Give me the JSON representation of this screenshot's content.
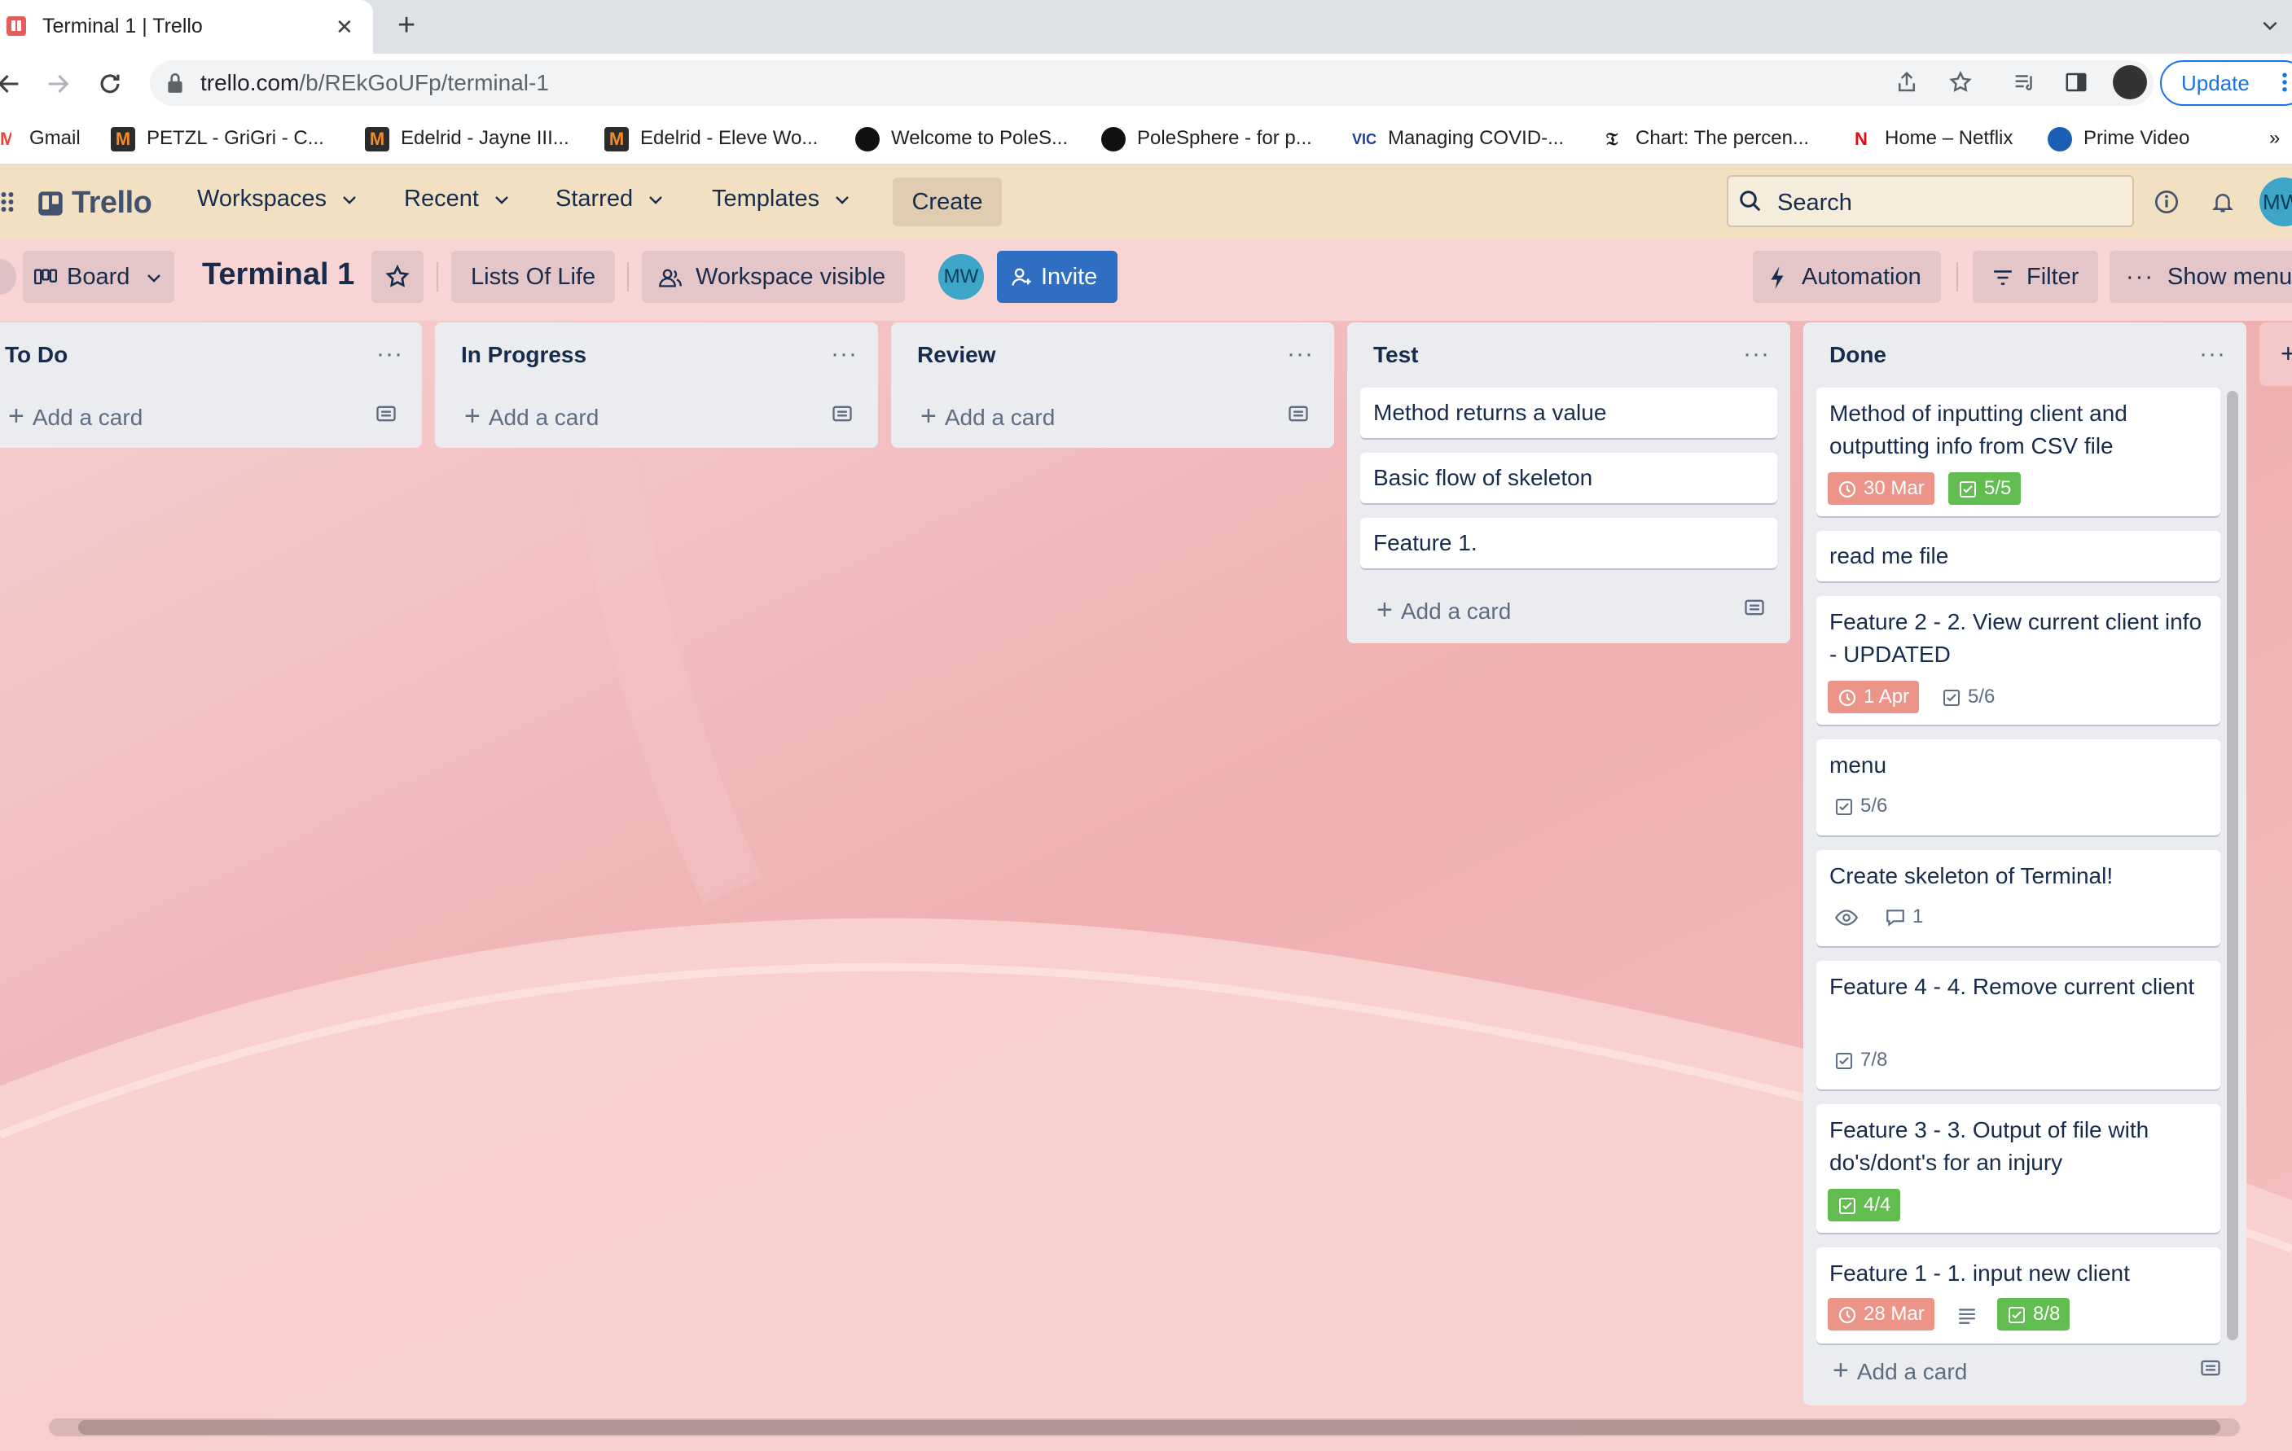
{
  "browser": {
    "tab_title": "Terminal 1 | Trello",
    "url_host": "trello.com",
    "url_path": "/b/REkGoUFp/terminal-1",
    "update_label": "Update",
    "bookmarks": [
      {
        "label": "Gmail",
        "icon": "gmail-icon"
      },
      {
        "label": "PETZL - GriGri - C...",
        "icon": "m-icon"
      },
      {
        "label": "Edelrid - Jayne III...",
        "icon": "m-icon"
      },
      {
        "label": "Edelrid - Eleve Wo...",
        "icon": "m-icon"
      },
      {
        "label": "Welcome to PoleS...",
        "icon": "polesphere-icon"
      },
      {
        "label": "PoleSphere - for p...",
        "icon": "polesphere-icon"
      },
      {
        "label": "Managing COVID-...",
        "icon": "vic-icon"
      },
      {
        "label": "Chart: The percen...",
        "icon": "nyt-icon"
      },
      {
        "label": "Home – Netflix",
        "icon": "netflix-icon"
      },
      {
        "label": "Prime Video",
        "icon": "prime-video-icon"
      }
    ],
    "bookmarks_overflow": "»"
  },
  "trello_header": {
    "logo": "Trello",
    "nav": [
      {
        "label": "Workspaces"
      },
      {
        "label": "Recent"
      },
      {
        "label": "Starred"
      },
      {
        "label": "Templates"
      }
    ],
    "create_label": "Create",
    "search_placeholder": "Search",
    "member_initials": "MW"
  },
  "board_header": {
    "view_label": "Board",
    "title": "Terminal 1",
    "workspace_name": "Lists Of Life",
    "visibility_label": "Workspace visible",
    "member_initials": "MW",
    "invite_label": "Invite",
    "automation_label": "Automation",
    "filter_label": "Filter",
    "show_menu_label": "Show menu"
  },
  "lists": [
    {
      "title": "To Do",
      "add_card_label": "Add a card",
      "cards": []
    },
    {
      "title": "In Progress",
      "add_card_label": "Add a card",
      "cards": []
    },
    {
      "title": "Review",
      "add_card_label": "Add a card",
      "cards": []
    },
    {
      "title": "Test",
      "add_card_label": "Add a card",
      "cards": [
        {
          "title": "Method returns a value"
        },
        {
          "title": "Basic flow of skeleton"
        },
        {
          "title": "Feature 1."
        }
      ]
    },
    {
      "title": "Done",
      "add_card_label": "Add a card",
      "cards": [
        {
          "title": "Method of inputting client and outputting info from CSV file",
          "badges": [
            {
              "type": "due",
              "text": "30 Mar",
              "color": "#ec9488"
            },
            {
              "type": "checklist",
              "text": "5/5",
              "color": "#61bd4f"
            }
          ]
        },
        {
          "title": "read me file",
          "badges": []
        },
        {
          "title": "Feature 2 - 2. View current client info - UPDATED",
          "badges": [
            {
              "type": "due",
              "text": "1 Apr",
              "color": "#ec9488"
            },
            {
              "type": "checklist",
              "text": "5/6"
            }
          ]
        },
        {
          "title": "menu",
          "badges": [
            {
              "type": "checklist",
              "text": "5/6"
            }
          ]
        },
        {
          "title": "Create skeleton of Terminal!",
          "badges": [
            {
              "type": "watch",
              "text": ""
            },
            {
              "type": "comments",
              "text": "1"
            }
          ]
        },
        {
          "title": "Feature 4 - 4. Remove current client",
          "badges": [
            {
              "type": "checklist",
              "text": "7/8"
            }
          ]
        },
        {
          "title": "Feature 3 - 3. Output of file with do's/dont's for an injury",
          "badges": [
            {
              "type": "checklist",
              "text": "4/4",
              "color": "#61bd4f"
            }
          ]
        },
        {
          "title": "Feature 1 - 1. input new client",
          "badges": [
            {
              "type": "due",
              "text": "28 Mar",
              "color": "#ec9488"
            },
            {
              "type": "description",
              "text": ""
            },
            {
              "type": "checklist",
              "text": "8/8",
              "color": "#61bd4f"
            }
          ]
        }
      ]
    }
  ]
}
